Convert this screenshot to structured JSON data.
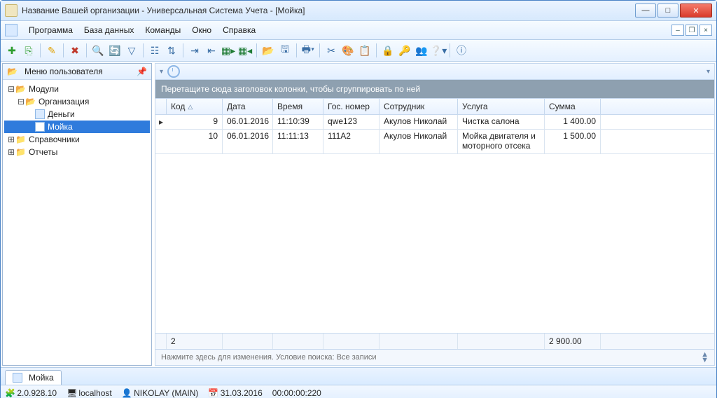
{
  "window": {
    "title": "Название Вашей организации - Универсальная Система Учета - [Мойка]"
  },
  "menu": {
    "program": "Программа",
    "database": "База данных",
    "commands": "Команды",
    "window": "Окно",
    "help": "Справка"
  },
  "sidebar": {
    "title": "Меню пользователя",
    "nodes": {
      "modules": "Модули",
      "org": "Организация",
      "money": "Деньги",
      "wash": "Мойка",
      "dicts": "Справочники",
      "reports": "Отчеты"
    }
  },
  "grid": {
    "group_hint": "Перетащите сюда заголовок колонки, чтобы сгруппировать по ней",
    "columns": {
      "code": "Код",
      "date": "Дата",
      "time": "Время",
      "plate": "Гос. номер",
      "employee": "Сотрудник",
      "service": "Услуга",
      "sum": "Сумма"
    },
    "rows": [
      {
        "code": "9",
        "date": "06.01.2016",
        "time": "11:10:39",
        "plate": "qwe123",
        "employee": "Акулов Николай",
        "service": "Чистка салона",
        "sum": "1 400.00"
      },
      {
        "code": "10",
        "date": "06.01.2016",
        "time": "11:11:13",
        "plate": "111A2",
        "employee": "Акулов Николай",
        "service": "Мойка двигателя и моторного отсека",
        "sum": "1 500.00"
      }
    ],
    "footer": {
      "count": "2",
      "total": "2 900.00"
    },
    "filter_prefix": "Нажмите здесь для изменения. Условие поиска: ",
    "filter_value": "Все записи"
  },
  "tabs": {
    "active": "Мойка"
  },
  "status": {
    "version": "2.0.928.10",
    "host": "localhost",
    "user": "NIKOLAY (MAIN)",
    "date": "31.03.2016",
    "elapsed": "00:00:00:220"
  },
  "colors": {
    "accent": "#2f7bdc"
  }
}
